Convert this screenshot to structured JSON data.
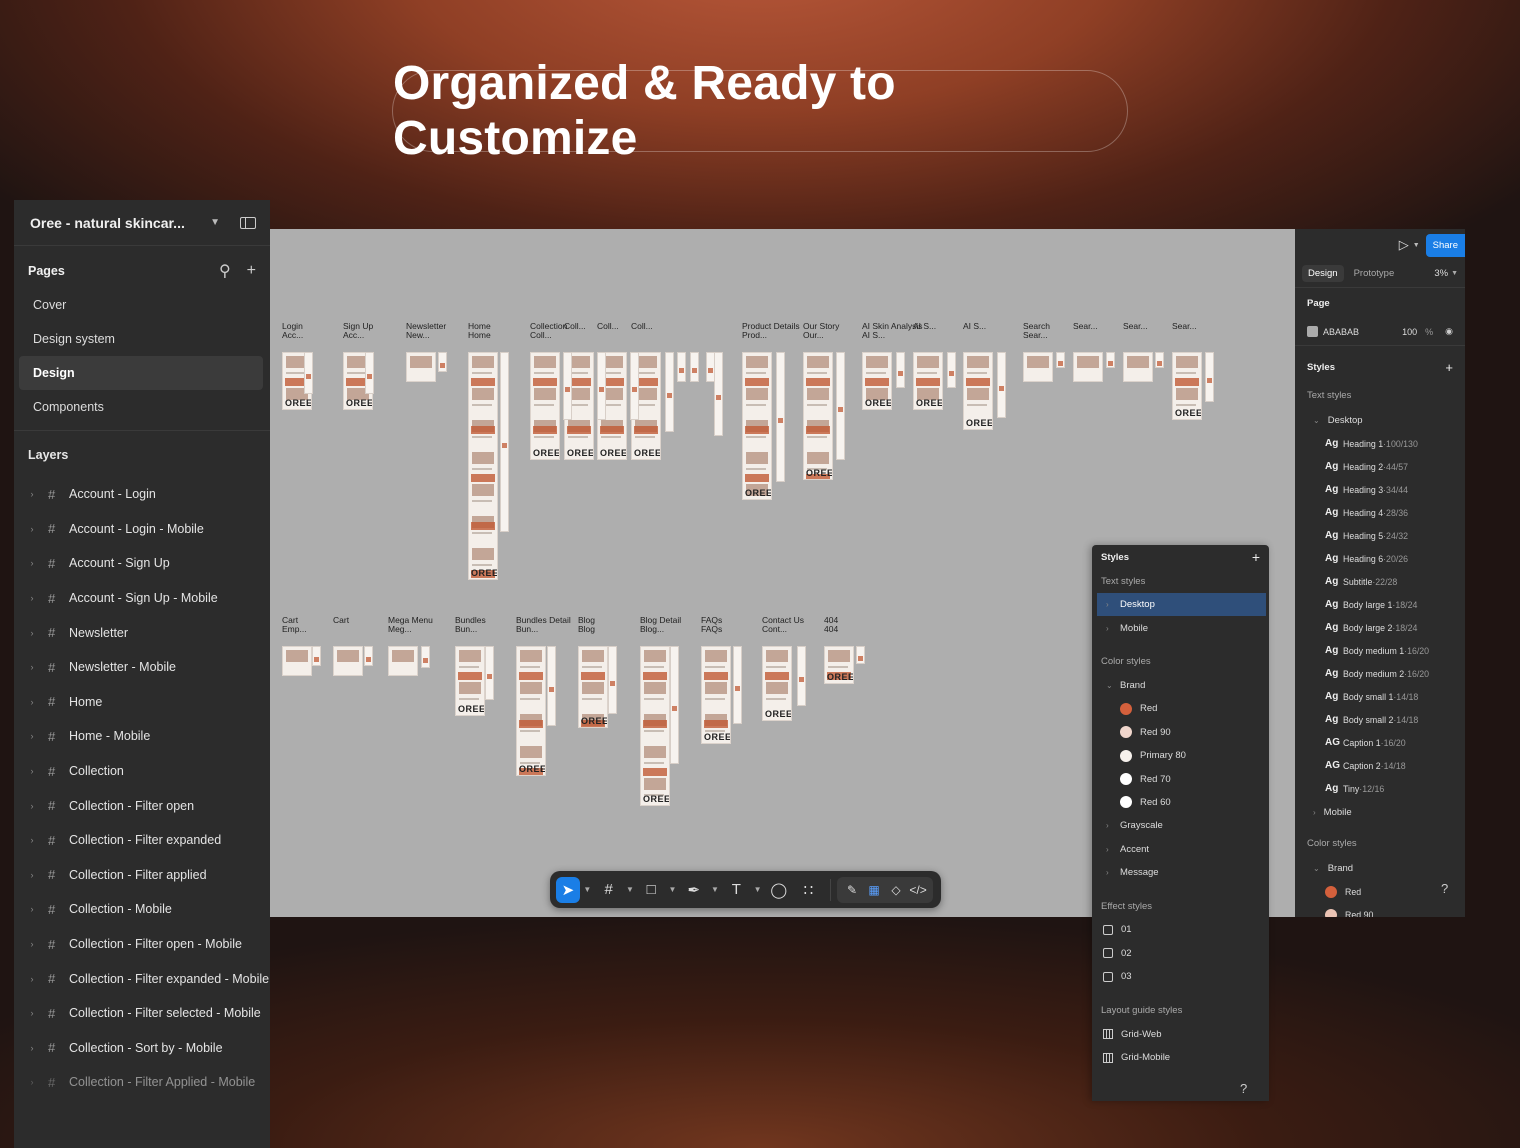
{
  "headline": "Organized & Ready to Customize",
  "left_panel": {
    "file_name": "Oree - natural skincar...",
    "pages_title": "Pages",
    "pages": [
      "Cover",
      "Design system",
      "Design",
      "Components"
    ],
    "selected_page": "Design",
    "layers_title": "Layers",
    "layers": [
      "Account - Login",
      "Account - Login - Mobile",
      "Account - Sign Up",
      "Account - Sign Up - Mobile",
      "Newsletter",
      "Newsletter - Mobile",
      "Home",
      "Home - Mobile",
      "Collection",
      "Collection - Filter open",
      "Collection - Filter expanded",
      "Collection - Filter applied",
      "Collection - Mobile",
      "Collection - Filter open - Mobile",
      "Collection - Filter expanded - Mobile",
      "Collection - Filter selected - Mobile",
      "Collection - Sort by - Mobile",
      "Collection - Filter Applied - Mobile"
    ]
  },
  "canvas": {
    "background": "#ABABAB",
    "brand_mark": "OREE",
    "row1_labels": [
      "Login\nAcc...",
      "Sign Up\nAcc...",
      "Newsletter\nNew...",
      "Home\nHome",
      "Collection\nColl...",
      "Coll...",
      "Coll...",
      "Coll...",
      "Product Details\nProd...",
      "Our Story\nOur...",
      "AI Skin Analysis\nAI S...",
      "AI S...",
      "AI S...",
      "Search\nSear...",
      "Sear...",
      "Sear...",
      "Sear..."
    ],
    "row2_labels": [
      "Cart\nEmp...",
      "Cart",
      "Mega Menu\nMeg...",
      "Bundles\nBun...",
      "Bundles Detail\nBun...",
      "Blog\nBlog",
      "Blog Detail\nBlog...",
      "FAQs\nFAQs",
      "Contact Us\nCont...",
      "404\n404"
    ]
  },
  "right_panel": {
    "share_label": "Share",
    "tabs": [
      "Design",
      "Prototype"
    ],
    "active_tab": "Design",
    "zoom": "3%",
    "page_section": "Page",
    "page_color_hex": "ABABAB",
    "page_opacity": "100",
    "page_opacity_unit": "%",
    "styles_section": "Styles",
    "text_styles_label": "Text styles",
    "desktop_group": "Desktop",
    "text_styles": [
      {
        "ag": "Ag",
        "name": "Heading 1",
        "meta": "100/130"
      },
      {
        "ag": "Ag",
        "name": "Heading 2",
        "meta": "44/57"
      },
      {
        "ag": "Ag",
        "name": "Heading 3",
        "meta": "34/44"
      },
      {
        "ag": "Ag",
        "name": "Heading 4",
        "meta": "28/36"
      },
      {
        "ag": "Ag",
        "name": "Heading 5",
        "meta": "24/32"
      },
      {
        "ag": "Ag",
        "name": "Heading 6",
        "meta": "20/26"
      },
      {
        "ag": "Ag",
        "name": "Subtitle",
        "meta": "22/28"
      },
      {
        "ag": "Ag",
        "name": "Body large 1",
        "meta": "18/24"
      },
      {
        "ag": "Ag",
        "name": "Body large 2",
        "meta": "18/24"
      },
      {
        "ag": "Ag",
        "name": "Body medium 1",
        "meta": "16/20"
      },
      {
        "ag": "Ag",
        "name": "Body medium 2",
        "meta": "16/20"
      },
      {
        "ag": "Ag",
        "name": "Body small 1",
        "meta": "14/18"
      },
      {
        "ag": "Ag",
        "name": "Body small 2",
        "meta": "14/18"
      },
      {
        "ag": "AG",
        "name": "Caption 1",
        "meta": "16/20"
      },
      {
        "ag": "AG",
        "name": "Caption 2",
        "meta": "14/18"
      },
      {
        "ag": "Ag",
        "name": "Tiny",
        "meta": "12/16"
      }
    ],
    "mobile_group": "Mobile",
    "color_styles_label": "Color styles",
    "brand_group": "Brand",
    "colors": [
      {
        "name": "Red",
        "hex": "#D4603C"
      },
      {
        "name": "Red 90",
        "hex": "#EBC3B4"
      }
    ],
    "help": "?"
  },
  "styles_panel": {
    "title": "Styles",
    "text_styles_label": "Text styles",
    "text_groups": [
      "Desktop",
      "Mobile"
    ],
    "selected_group": "Desktop",
    "color_styles_label": "Color styles",
    "brand_group": "Brand",
    "brand_colors": [
      {
        "name": "Red",
        "hex": "#D4603C"
      },
      {
        "name": "Red 90",
        "hex": "#F0D6CC"
      },
      {
        "name": "Primary 80",
        "hex": "#F6F1EC"
      },
      {
        "name": "Red 70",
        "hex": "#FFFFFF"
      },
      {
        "name": "Red 60",
        "hex": "#FFFFFF"
      }
    ],
    "other_groups": [
      "Grayscale",
      "Accent",
      "Message"
    ],
    "effect_styles_label": "Effect styles",
    "effects": [
      "01",
      "02",
      "03"
    ],
    "layout_guide_label": "Layout guide styles",
    "grids": [
      "Grid-Web",
      "Grid-Mobile"
    ],
    "help": "?"
  },
  "toolbar": {
    "tools": [
      "move-tool",
      "frame-tool",
      "shape-tool",
      "pen-tool",
      "text-tool",
      "comment-tool",
      "actions-tool",
      "draw-mode",
      "design-mode",
      "dev-components",
      "dev-mode"
    ],
    "active_tool": "move-tool"
  }
}
